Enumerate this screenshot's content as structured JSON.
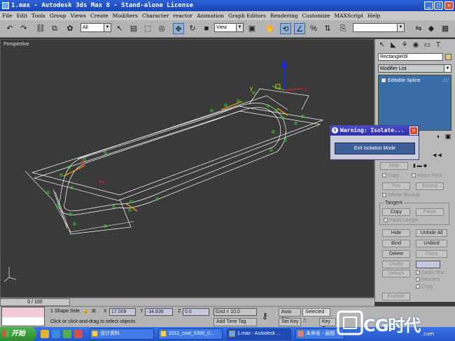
{
  "window": {
    "title": "1.max - Autodesk 3ds Max 8 - Stand-alone License",
    "controls": [
      "_",
      "□",
      "✕"
    ]
  },
  "menu": [
    "File",
    "Edit",
    "Tools",
    "Group",
    "Views",
    "Create",
    "Modifiers",
    "Character",
    "reactor",
    "Animation",
    "Graph Editors",
    "Rendering",
    "Customize",
    "MAXScript",
    "Help"
  ],
  "toolbar": {
    "selection_filter": "All",
    "reference_coord": "View"
  },
  "viewport": {
    "label": "Perspective"
  },
  "command_panel": {
    "object_name": "Rectangle09",
    "modifier_list": "Modifier List",
    "stack_item": "Editable Spline",
    "buttons": {
      "help": "Help",
      "copy": "Copy",
      "about_pivot": "About Pivot",
      "trim": "Trim",
      "extend": "Extend",
      "infinite_bounds": "Infinite Bounds",
      "tangent": "Tangent",
      "tangent_copy": "Copy",
      "tangent_paste": "Paste",
      "paste_length": "Paste Length",
      "hide": "Hide",
      "unhide_all": "Unhide All",
      "bind": "Bind",
      "unbind": "Unbind",
      "delete": "Delete",
      "close": "Close",
      "divide": "Divide",
      "detach": "Detach",
      "same_shp": "Same Shp",
      "reorient": "Reorient",
      "detach_copy": "Copy",
      "explode": "Explode"
    }
  },
  "dialog": {
    "title": "Warning: Isolate...",
    "button": "Exit Isolation Mode"
  },
  "time_slider": {
    "position": "0 / 100"
  },
  "status": {
    "selection": "1 Shape Sele",
    "prompt": "Click or click-and-drag to select objects",
    "x_label": "X",
    "x_value": "17.009",
    "y_label": "Y",
    "y_value": "-34.836",
    "z_label": "Z",
    "z_value": "0.0",
    "grid": "Grid = 10.0",
    "add_time_tag": "Add Time Tag",
    "auto_key": "Auto Key",
    "auto_key_mode": "Selected",
    "set_key": "Set Key",
    "key_filters": "Key Fi"
  },
  "taskbar": {
    "start": "开始",
    "tasks": [
      "设计资料",
      "1011_cool_5300_0...",
      "1.max - Autodesk ...",
      "未命名 - 画图"
    ]
  },
  "watermark": {
    "text": "CG时代",
    "sub": ".com"
  },
  "colors": {
    "spline": "#ffffff",
    "vertex": "#33cc33",
    "segment": "#ffaa00",
    "gizmo_x": "#e02020",
    "gizmo_y": "#30c030",
    "gizmo_z": "#1a2ad8",
    "viewport_bg": "#3a3a3a"
  }
}
